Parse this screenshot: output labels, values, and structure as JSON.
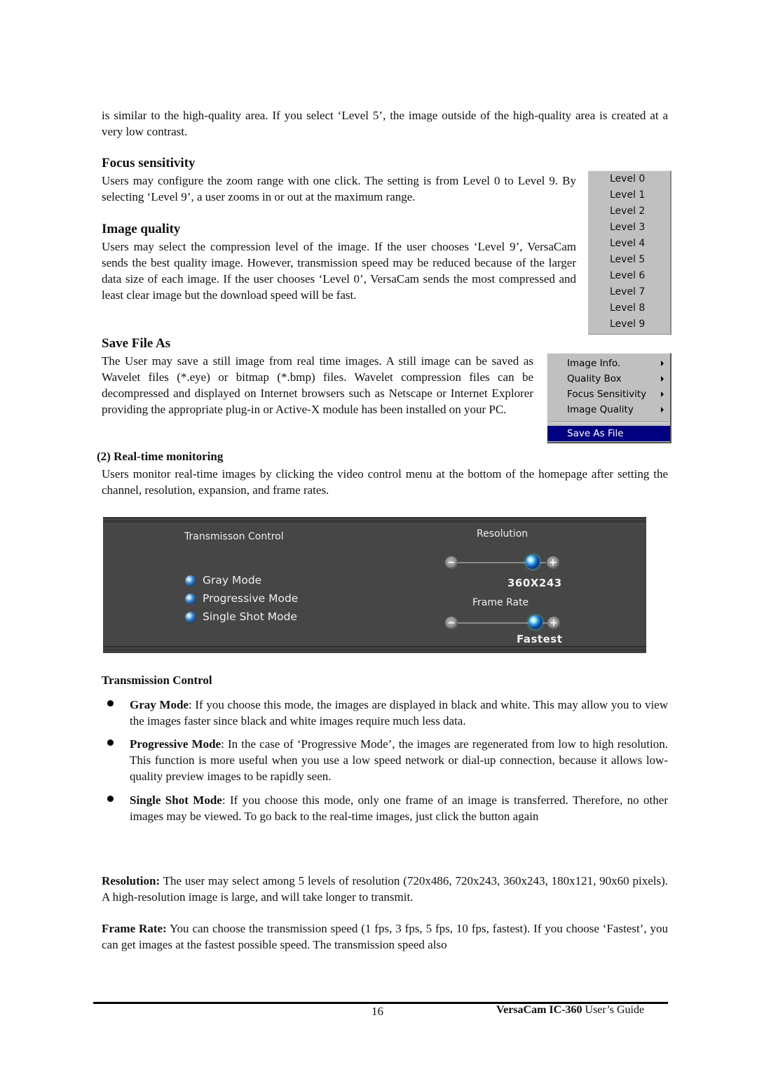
{
  "intro_text": "is similar to the high-quality area. If you select ‘Level 5’, the image outside of the high-quality area is created at a very low contrast.",
  "focus": {
    "heading": "Focus sensitivity",
    "body": "Users may configure the zoom range with one click. The setting is from Level 0 to Level 9. By selecting ‘Level 9’, a user zooms in or out at the maximum range."
  },
  "quality": {
    "heading": "Image quality",
    "body": "Users may select the compression level of the image. If the user chooses ‘Level 9’, VersaCam sends the best quality image. However, transmission speed may be reduced because of the larger data size of each image. If the user chooses ‘Level 0’, VersaCam sends the most compressed and least clear image but the download speed will be fast."
  },
  "level_menu": {
    "items": [
      "Level 0",
      "Level 1",
      "Level 2",
      "Level 3",
      "Level 4",
      "Level 5",
      "Level 6",
      "Level 7",
      "Level 8",
      "Level 9"
    ]
  },
  "save": {
    "heading": "Save File As",
    "body": "The User may save a still image from real time images. A still image can be saved as Wavelet files (*.eye) or bitmap (*.bmp) files. Wavelet compression files can be decompressed and displayed on Internet browsers such as Netscape or Internet Explorer providing the appropriate plug-in or Active-X module has been installed on your PC."
  },
  "context_menu": {
    "items": [
      {
        "label": "Image Info.",
        "submenu": true
      },
      {
        "label": "Quality Box",
        "submenu": true
      },
      {
        "label": "Focus Sensitivity",
        "submenu": true
      },
      {
        "label": "Image Quality",
        "submenu": true
      }
    ],
    "selected_item": "Save As File",
    "highlight_color": "#000080"
  },
  "realtime": {
    "heading": "(2) Real-time monitoring",
    "body": "Users monitor real-time images by clicking the video control menu at the bottom of the homepage after setting the channel, resolution, expansion, and frame rates."
  },
  "control_panel": {
    "background": "#464646",
    "transmission_title": "Transmisson Control",
    "modes": [
      "Gray Mode",
      "Progressive Mode",
      "Single Shot Mode"
    ],
    "resolution_label": "Resolution",
    "resolution_value": "360X243",
    "resolution_slider_fraction": 0.85,
    "frame_rate_label": "Frame Rate",
    "frame_rate_value": "Fastest",
    "frame_rate_slider_fraction": 0.87,
    "minus_symbol": "−",
    "plus_symbol": "+"
  },
  "transmission": {
    "heading": "Transmission Control",
    "bullets": [
      {
        "term": "Gray Mode",
        "text": ": If you choose this mode, the images are displayed in black and white. This may allow you to view the images faster since black and white images require much less data."
      },
      {
        "term": "Progressive Mode",
        "text": ": In the case of ‘Progressive Mode’, the images are regenerated from low to high resolution. This function is more useful when you use a low speed network or dial-up connection, because it allows low-quality preview images to be rapidly seen."
      },
      {
        "term": "Single Shot Mode",
        "text": ": If you choose this mode, only one frame of an image is transferred. Therefore, no other images may be viewed. To go back to the real-time images, just click the button again"
      }
    ]
  },
  "resolution_para": {
    "term": "Resolution:",
    "text": " The user may select among 5 levels of resolution (720x486, 720x243, 360x243, 180x121, 90x60 pixels). A high-resolution image is large, and will take longer to transmit."
  },
  "framerate_para": {
    "term": "Frame Rate:",
    "text": " You can choose the transmission speed (1 fps, 3 fps, 5 fps, 10 fps, fastest). If you choose ‘Fastest’, you can get images at the fastest possible speed. The transmission speed also"
  },
  "footer": {
    "page_number": "16",
    "product_bold": "VersaCam IC-360",
    "guide_text": " User’s Guide"
  }
}
